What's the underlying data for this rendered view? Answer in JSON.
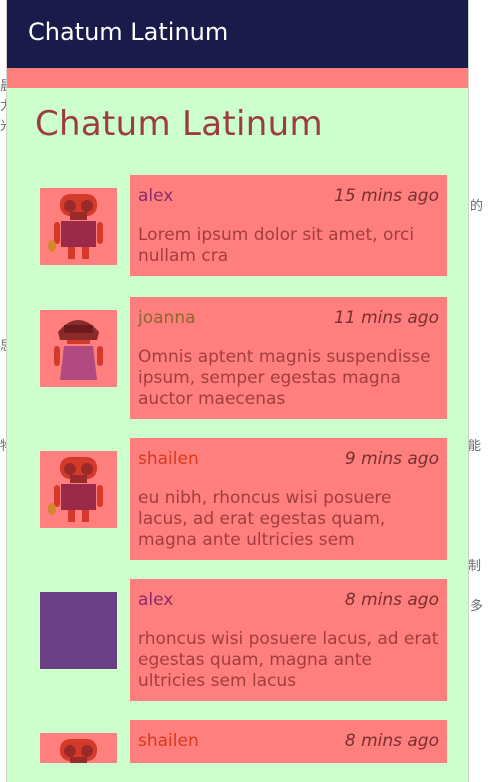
{
  "app": {
    "toolbar_title": "Chatum Latinum",
    "page_title": "Chatum Latinum"
  },
  "colors": {
    "toolbar_bg": "#1a1b4b",
    "content_bg": "#ccffcc",
    "card_bg": "#ff7f7f",
    "name_alex": "#8b2b6b",
    "name_joanna": "#8a6a2a",
    "name_shailen": "#d83a1a",
    "avatar_placeholder": "#6a3f84"
  },
  "messages": [
    {
      "name": "alex",
      "time": "15 mins ago",
      "text": "Lorem ipsum dolor sit amet, orci nullam cra",
      "avatar": "bearded-android-icon"
    },
    {
      "name": "joanna",
      "time": "11 mins ago",
      "text": "Omnis aptent magnis suspendisse ipsum, semper egestas magna auctor maecenas",
      "avatar": "girl-android-icon"
    },
    {
      "name": "shailen",
      "time": "9 mins ago",
      "text": "eu nibh, rhoncus wisi posuere lacus, ad erat egestas quam, magna ante ultricies sem",
      "avatar": "bearded-android-icon"
    },
    {
      "name": "alex",
      "time": "8 mins ago",
      "text": "rhoncus wisi posuere lacus, ad erat egestas quam, magna ante ultricies sem lacus",
      "avatar": "placeholder-avatar"
    },
    {
      "name": "shailen",
      "time": "8 mins ago",
      "text": "",
      "avatar": "bearded-android-icon"
    }
  ],
  "background_glyphs": [
    "晨",
    "力",
    "光",
    "思",
    "物",
    "能",
    "的",
    "制",
    "多"
  ]
}
